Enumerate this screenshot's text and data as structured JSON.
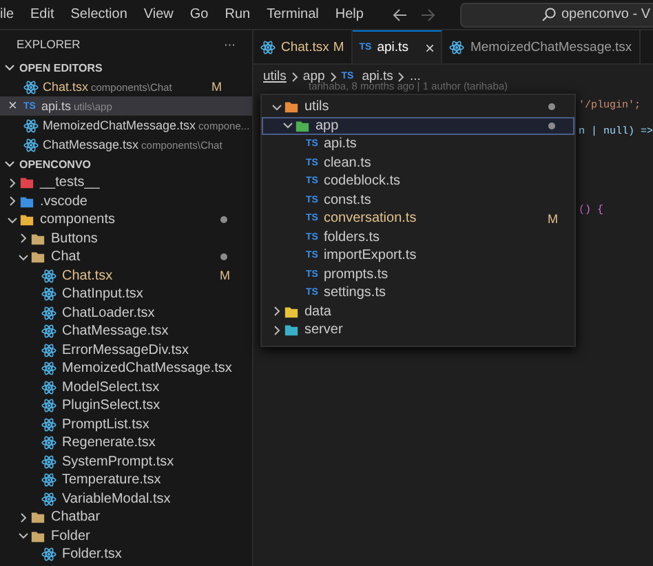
{
  "menu": [
    "ile",
    "Edit",
    "Selection",
    "View",
    "Go",
    "Run",
    "Terminal",
    "Help"
  ],
  "search": {
    "value": "openconvo - V"
  },
  "sidebar": {
    "title": "EXPLORER",
    "more": "···",
    "open_editors": {
      "title": "OPEN EDITORS",
      "expanded": true,
      "items": [
        {
          "name": "Chat.tsx",
          "path": "components\\Chat",
          "kind": "react",
          "status": "M",
          "selected": false
        },
        {
          "name": "api.ts",
          "path": "utils\\app",
          "kind": "ts",
          "badge": "TS",
          "close": "×",
          "selected": true
        },
        {
          "name": "MemoizedChatMessage.tsx",
          "path": "compone...",
          "kind": "react",
          "selected": false
        },
        {
          "name": "ChatMessage.tsx",
          "path": "components\\Chat",
          "kind": "react",
          "selected": false
        }
      ]
    },
    "project": {
      "title": "OPENCONVO",
      "expanded": true,
      "tree": [
        {
          "name": "__tests__",
          "kind": "folder",
          "color": "#e0434b",
          "expanded": false
        },
        {
          "name": ".vscode",
          "kind": "folder",
          "color": "#3a8fe0",
          "expanded": false
        },
        {
          "name": "components",
          "kind": "folder",
          "color": "#e8b33a",
          "expanded": true,
          "dot": true,
          "children": [
            {
              "name": "Buttons",
              "kind": "folder",
              "color": "#c9a86a",
              "expanded": false
            },
            {
              "name": "Chat",
              "kind": "folder",
              "color": "#c9a86a",
              "expanded": true,
              "dot": true,
              "children": [
                {
                  "name": "Chat.tsx",
                  "kind": "react",
                  "modified": true,
                  "status": "M"
                },
                {
                  "name": "ChatInput.tsx",
                  "kind": "react"
                },
                {
                  "name": "ChatLoader.tsx",
                  "kind": "react"
                },
                {
                  "name": "ChatMessage.tsx",
                  "kind": "react"
                },
                {
                  "name": "ErrorMessageDiv.tsx",
                  "kind": "react"
                },
                {
                  "name": "MemoizedChatMessage.tsx",
                  "kind": "react"
                },
                {
                  "name": "ModelSelect.tsx",
                  "kind": "react"
                },
                {
                  "name": "PluginSelect.tsx",
                  "kind": "react"
                },
                {
                  "name": "PromptList.tsx",
                  "kind": "react"
                },
                {
                  "name": "Regenerate.tsx",
                  "kind": "react"
                },
                {
                  "name": "SystemPrompt.tsx",
                  "kind": "react"
                },
                {
                  "name": "Temperature.tsx",
                  "kind": "react"
                },
                {
                  "name": "VariableModal.tsx",
                  "kind": "react"
                }
              ]
            },
            {
              "name": "Chatbar",
              "kind": "folder",
              "color": "#c9a86a",
              "expanded": false
            },
            {
              "name": "Folder",
              "kind": "folder",
              "color": "#c9a86a",
              "expanded": true,
              "children": [
                {
                  "name": "Folder.tsx",
                  "kind": "react"
                }
              ]
            }
          ]
        }
      ]
    }
  },
  "tabs": [
    {
      "label": "Chat.tsx",
      "kind": "react",
      "status": "M",
      "selected": false
    },
    {
      "label": "api.ts",
      "kind": "ts",
      "badge": "TS",
      "close": "×",
      "selected": true
    },
    {
      "label": "MemoizedChatMessage.tsx",
      "kind": "react",
      "selected": false
    }
  ],
  "breadcrumbs": [
    {
      "label": "utils"
    },
    {
      "label": "app"
    },
    {
      "label": "api.ts",
      "badge": "TS"
    },
    {
      "label": "..."
    }
  ],
  "editor": {
    "codelens": "tarihaba, 8 months ago | 1 author (tarihaba)",
    "lines": [
      {
        "text": "'/plugin';"
      },
      {
        "text": "n | null) =>"
      },
      {
        "text": "() {"
      }
    ]
  },
  "popup": {
    "tree": [
      {
        "name": "utils",
        "kind": "folder",
        "color": "#e8893a",
        "expanded": true,
        "dot": true,
        "children": [
          {
            "name": "app",
            "kind": "folder",
            "color": "#4caf50",
            "expanded": true,
            "dot": true,
            "selected": true,
            "children": [
              {
                "name": "api.ts",
                "kind": "ts",
                "badge": "TS"
              },
              {
                "name": "clean.ts",
                "kind": "ts",
                "badge": "TS"
              },
              {
                "name": "codeblock.ts",
                "kind": "ts",
                "badge": "TS"
              },
              {
                "name": "const.ts",
                "kind": "ts",
                "badge": "TS"
              },
              {
                "name": "conversation.ts",
                "kind": "ts",
                "badge": "TS",
                "modified": true,
                "status": "M"
              },
              {
                "name": "folders.ts",
                "kind": "ts",
                "badge": "TS"
              },
              {
                "name": "importExport.ts",
                "kind": "ts",
                "badge": "TS"
              },
              {
                "name": "prompts.ts",
                "kind": "ts",
                "badge": "TS"
              },
              {
                "name": "settings.ts",
                "kind": "ts",
                "badge": "TS"
              }
            ]
          }
        ]
      },
      {
        "name": "data",
        "kind": "folder",
        "color": "#e8c33a",
        "expanded": false
      },
      {
        "name": "server",
        "kind": "folder",
        "color": "#3ab0c8",
        "expanded": false
      }
    ]
  }
}
